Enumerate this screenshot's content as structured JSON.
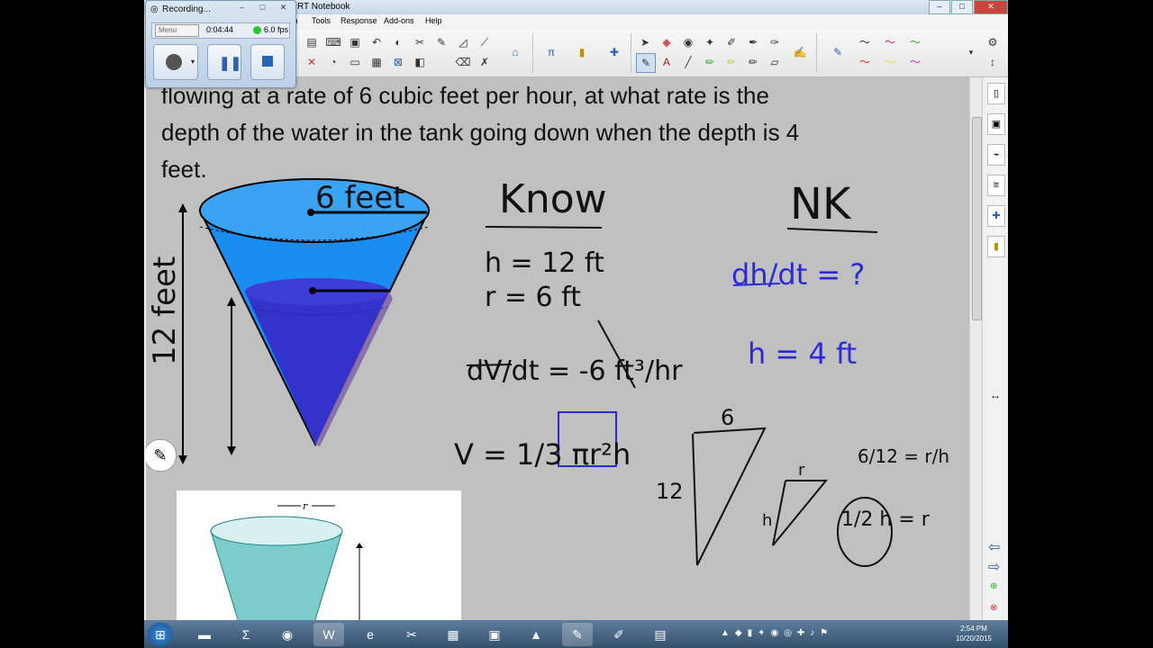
{
  "window": {
    "title": "SMART Notebook",
    "title_visible": "RT Notebook"
  },
  "menu": [
    "th",
    "Tools",
    "Response",
    "Add-ons",
    "Help"
  ],
  "recorder": {
    "title": "Recording...",
    "menu_label": "Menu",
    "elapsed": "0:04:44",
    "fps": "6.0 fps"
  },
  "problem_text": {
    "line1": "flowing at a rate of 6 cubic feet per hour, at what rate is the",
    "line2": "depth of the water in the tank going down when the depth is 4",
    "line3": "feet."
  },
  "diagram": {
    "radius_label": "6 feet",
    "height_label": "12 feet",
    "r_label": "r"
  },
  "handwriting": {
    "know_title": "Know",
    "nk_title": "NK",
    "h_value": "h = 12 ft",
    "r_value": "r = 6 ft",
    "dv_dt": "dV/dt = -6 ft³/hr",
    "volume": "V = 1/3 πr²h",
    "dh_dt": "dh/dt = ?",
    "h_given": "h = 4 ft",
    "tri_top": "6",
    "tri_side": "12",
    "small_top": "r",
    "small_side": "h",
    "ratio": "6/12 = r/h",
    "result": "1/2 h = r"
  },
  "clock": {
    "time": "2:54 PM",
    "date": "10/20/2015"
  },
  "colors": {
    "water_light": "#1a8df0",
    "water_dark": "#3333cc",
    "ink_blue": "#2b2bd6",
    "ink_black": "#111111",
    "canvas": "#c0c0c0"
  }
}
